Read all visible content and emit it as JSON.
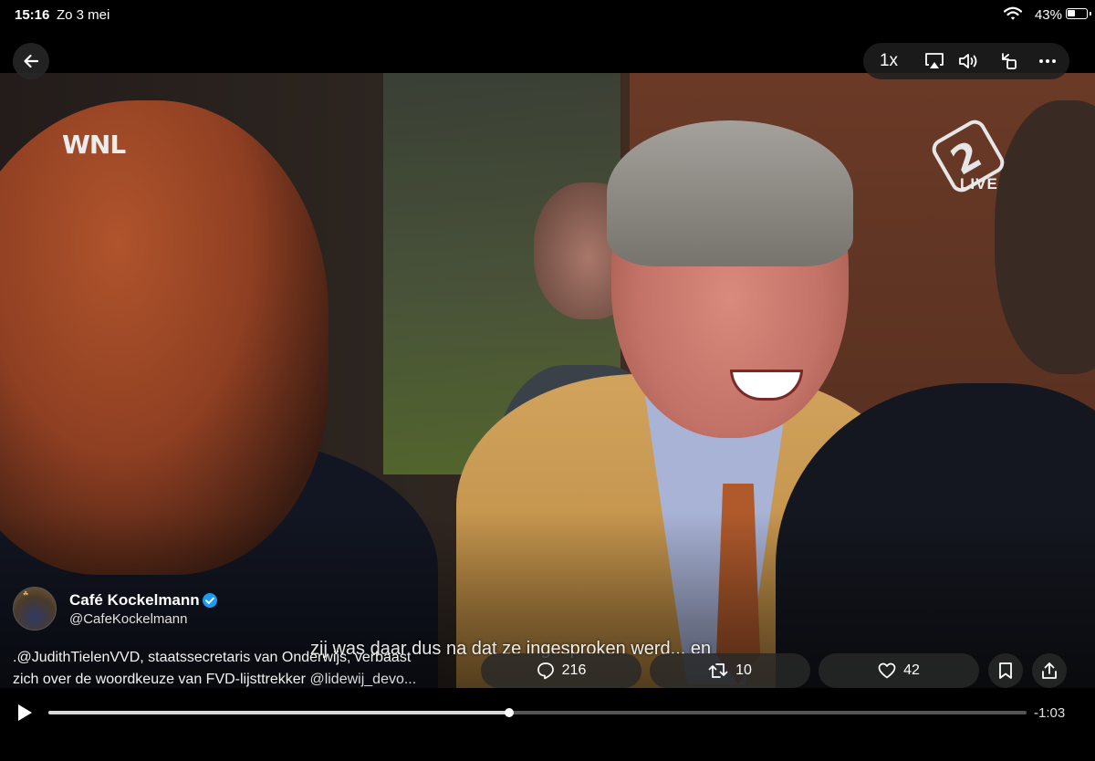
{
  "status_bar": {
    "time": "15:16",
    "date": "Zo 3 mei",
    "battery_percent": "43%",
    "battery_level": 0.43
  },
  "video": {
    "broadcaster_logo": "WNL",
    "channel_logo": "npo-2",
    "live_label": "LIVE",
    "subtitle": "zij was daar dus na dat ze ingesproken werd... en"
  },
  "controls": {
    "back_icon": "arrow-left-icon",
    "speed_label": "1x",
    "airplay_icon": "airplay-icon",
    "volume_icon": "speaker-icon",
    "rotate_icon": "rotate-icon",
    "more_icon": "ellipsis-icon"
  },
  "tweet": {
    "author_name": "Café Kockelmann",
    "verified": true,
    "author_handle": "@CafeKockelmann",
    "text_line1": ".@JudithTielenVVD, staatssecretaris van Onderwijs, verbaast",
    "text_line2_prefix": "zich over de woordkeuze van FVD-lijsttrekker ",
    "text_line2_mention": "@lidewij_devo..."
  },
  "actions": {
    "replies": "216",
    "retweets": "10",
    "likes": "42",
    "reply_icon": "comment-icon",
    "retweet_icon": "retweet-icon",
    "like_icon": "heart-icon",
    "bookmark_icon": "bookmark-icon",
    "share_icon": "share-icon"
  },
  "player": {
    "remaining_time": "-1:03",
    "progress": 0.471,
    "play_icon": "play-icon"
  },
  "colors": {
    "verified_badge": "#1d9bf0",
    "background": "#000000"
  }
}
